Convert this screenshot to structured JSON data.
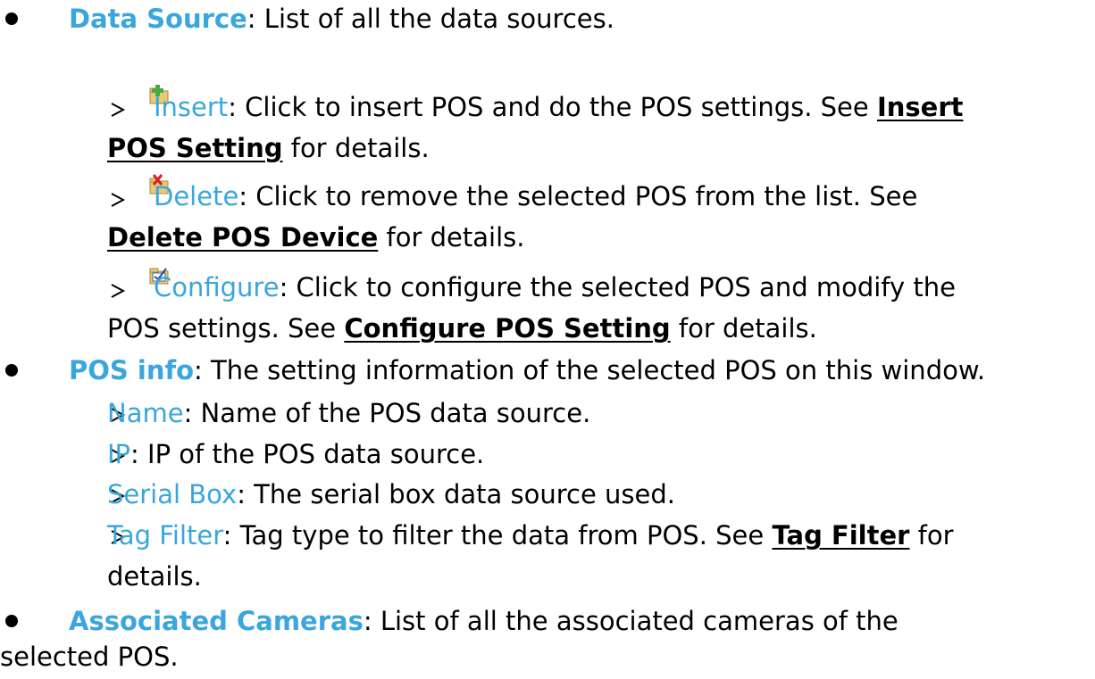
{
  "data_source": {
    "term": "Data Source",
    "desc": ": List of all the data sources."
  },
  "insert": {
    "icon": "insert-pos-icon",
    "term": "Insert",
    "desc1": ": Click to insert POS and do the POS settings. See ",
    "link_a": "Insert ",
    "link_b": "POS Setting",
    "desc2": " for details."
  },
  "delete": {
    "icon": "delete-pos-icon",
    "term": "Delete",
    "desc1": ": Click to remove the selected POS from the list. See",
    "link": "Delete POS Device",
    "desc2": " for details."
  },
  "configure": {
    "icon": "configure-pos-icon",
    "term": "Configure",
    "desc1": ": Click to configure the selected POS and modify the",
    "desc2": "POS settings. See ",
    "link": "Configure POS Setting",
    "desc3": " for details."
  },
  "pos_info": {
    "term": "POS info",
    "desc": ": The setting information of the selected POS on this window."
  },
  "name": {
    "term": "Name",
    "desc": ": Name of the POS data source."
  },
  "ip": {
    "term": "IP",
    "desc": ": IP of the POS data source."
  },
  "serial_box": {
    "term": "Serial Box",
    "desc": ": The serial box data source used."
  },
  "tag_filter": {
    "term": "Tag Filter",
    "desc1": ": Tag type to filter the data from POS. See ",
    "link": "Tag Filter",
    "desc2": " for",
    "desc3": "details."
  },
  "associated_cameras": {
    "term": "Associated Cameras",
    "desc1": ": List of all the associated cameras of the",
    "desc2": "selected POS."
  },
  "colors": {
    "term": "#3aa6dd",
    "text": "#000000"
  }
}
